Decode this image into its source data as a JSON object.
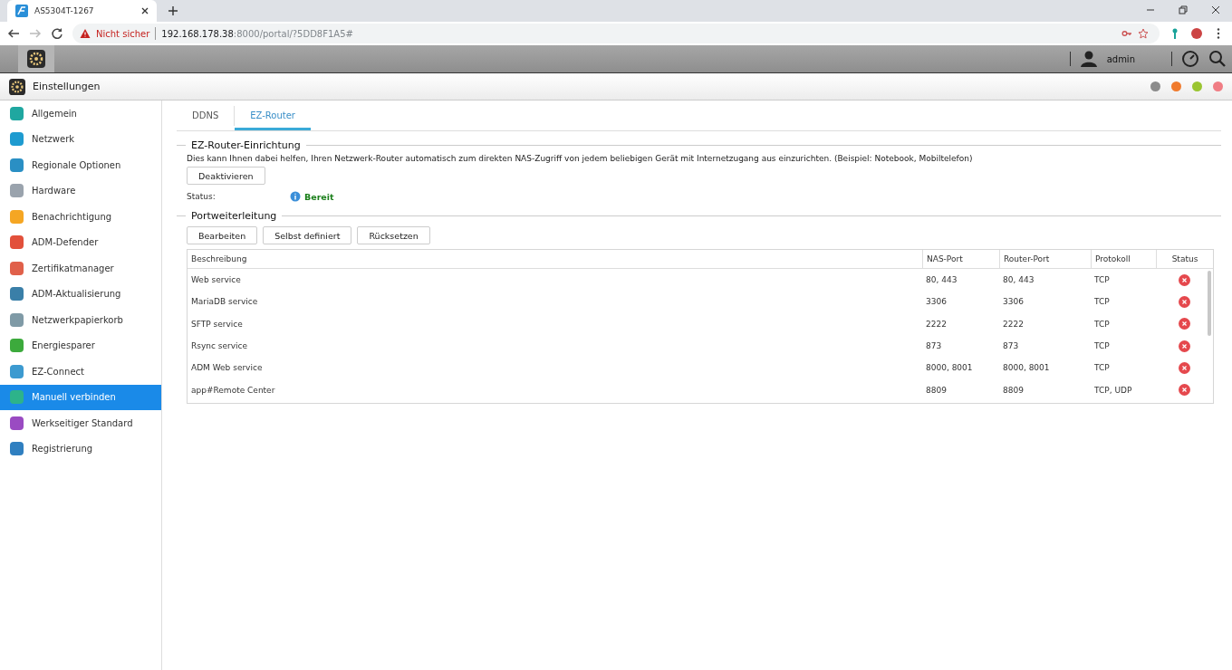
{
  "browser": {
    "tab_title": "AS5304T-1267",
    "security": "Nicht sicher",
    "url_host": "192.168.178.38",
    "url_rest": ":8000/portal/?5DD8F1A5#"
  },
  "topbar": {
    "user": "admin"
  },
  "app": {
    "title": "Einstellungen"
  },
  "sidebar": {
    "items": [
      {
        "label": "Allgemein",
        "selected": false,
        "color": "#1fa7a0"
      },
      {
        "label": "Netzwerk",
        "selected": false,
        "color": "#1e9bd0"
      },
      {
        "label": "Regionale Optionen",
        "selected": false,
        "color": "#2a8fc4"
      },
      {
        "label": "Hardware",
        "selected": false,
        "color": "#9aa3ad"
      },
      {
        "label": "Benachrichtigung",
        "selected": false,
        "color": "#f5a623"
      },
      {
        "label": "ADM-Defender",
        "selected": false,
        "color": "#e2503b"
      },
      {
        "label": "Zertifikatmanager",
        "selected": false,
        "color": "#e0604a"
      },
      {
        "label": "ADM-Aktualisierung",
        "selected": false,
        "color": "#3a7fa8"
      },
      {
        "label": "Netzwerkpapierkorb",
        "selected": false,
        "color": "#7f9aa6"
      },
      {
        "label": "Energiesparer",
        "selected": false,
        "color": "#3caa3c"
      },
      {
        "label": "EZ-Connect",
        "selected": false,
        "color": "#3c9ad0"
      },
      {
        "label": "Manuell verbinden",
        "selected": true,
        "color": "#2db38a"
      },
      {
        "label": "Werkseitiger Standard",
        "selected": false,
        "color": "#9a4bc2"
      },
      {
        "label": "Registrierung",
        "selected": false,
        "color": "#2f7fc0"
      }
    ]
  },
  "tabs": [
    {
      "label": "DDNS",
      "selected": false
    },
    {
      "label": "EZ-Router",
      "selected": true
    }
  ],
  "setup": {
    "heading": "EZ-Router-Einrichtung",
    "description": "Dies kann Ihnen dabei helfen, Ihren Netzwerk-Router automatisch zum direkten NAS-Zugriff von jedem beliebigen Gerät mit Internetzugang aus einzurichten. (Beispiel: Notebook, Mobiltelefon)",
    "button": "Deaktivieren",
    "status_label": "Status:",
    "status_value": "Bereit"
  },
  "forwarding": {
    "heading": "Portweiterleitung",
    "buttons": [
      "Bearbeiten",
      "Selbst definiert",
      "Rücksetzen"
    ],
    "table": {
      "columns": [
        "Beschreibung",
        "NAS-Port",
        "Router-Port",
        "Protokoll",
        "Status"
      ],
      "rows": [
        {
          "description": "Web service",
          "nas_port": "80, 443",
          "router_port": "80, 443",
          "protocol": "TCP",
          "failed": true
        },
        {
          "description": "MariaDB service",
          "nas_port": "3306",
          "router_port": "3306",
          "protocol": "TCP",
          "failed": true
        },
        {
          "description": "SFTP service",
          "nas_port": "2222",
          "router_port": "2222",
          "protocol": "TCP",
          "failed": true
        },
        {
          "description": "Rsync service",
          "nas_port": "873",
          "router_port": "873",
          "protocol": "TCP",
          "failed": true
        },
        {
          "description": "ADM Web service",
          "nas_port": "8000, 8001",
          "router_port": "8000, 8001",
          "protocol": "TCP",
          "failed": true
        },
        {
          "description": "app#Remote Center",
          "nas_port": "8809",
          "router_port": "8809",
          "protocol": "TCP, UDP",
          "failed": true
        }
      ]
    }
  }
}
